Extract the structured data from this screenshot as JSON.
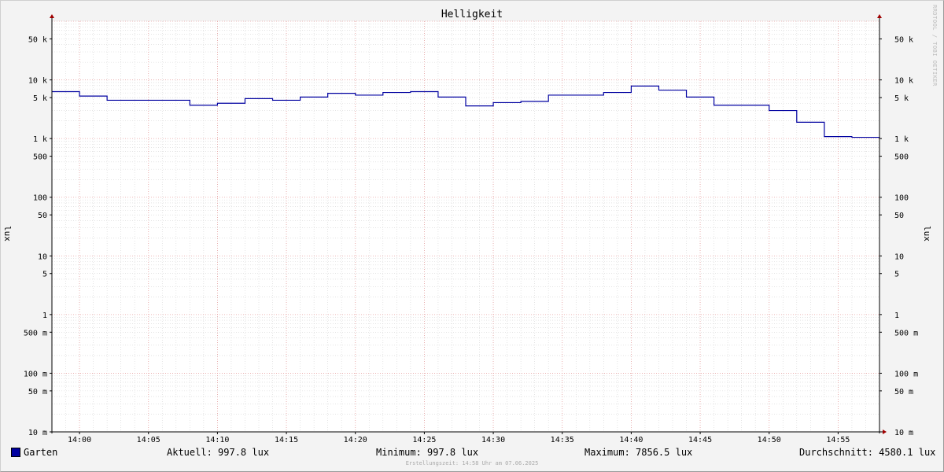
{
  "window": {
    "watermark": "RRDTOOL / TOBI OETIKER"
  },
  "chart_data": {
    "type": "line",
    "title": "Helligkeit",
    "ylabel": "lux",
    "ylabel_right": "lux",
    "y_scale": "log",
    "ylim": [
      0.01,
      100000
    ],
    "y_ticks": [
      {
        "value": 50000,
        "label": "50 k"
      },
      {
        "value": 10000,
        "label": "10 k"
      },
      {
        "value": 5000,
        "label": "5 k"
      },
      {
        "value": 1000,
        "label": "1 k"
      },
      {
        "value": 500,
        "label": "500"
      },
      {
        "value": 100,
        "label": "100"
      },
      {
        "value": 50,
        "label": "50"
      },
      {
        "value": 10,
        "label": "10"
      },
      {
        "value": 5,
        "label": "5"
      },
      {
        "value": 1,
        "label": "1"
      },
      {
        "value": 0.5,
        "label": "500 m"
      },
      {
        "value": 0.1,
        "label": "100 m"
      },
      {
        "value": 0.05,
        "label": "50 m"
      },
      {
        "value": 0.01,
        "label": "10 m"
      }
    ],
    "xlim": [
      "13:58",
      "14:58"
    ],
    "x_ticks": [
      "14:00",
      "14:05",
      "14:10",
      "14:15",
      "14:20",
      "14:25",
      "14:30",
      "14:35",
      "14:40",
      "14:45",
      "14:50",
      "14:55"
    ],
    "grid": true,
    "legend_position": "bottom-left",
    "colors": {
      "line": "#0000a0",
      "grid_major": "#e8a0a0",
      "grid_minor": "#d4d4d4",
      "axis": "#000000"
    },
    "series": [
      {
        "name": "Garten",
        "step": true,
        "x": [
          "13:58",
          "14:00",
          "14:02",
          "14:06",
          "14:08",
          "14:10",
          "14:12",
          "14:14",
          "14:16",
          "14:18",
          "14:20",
          "14:22",
          "14:24",
          "14:26",
          "14:28",
          "14:30",
          "14:32",
          "14:34",
          "14:38",
          "14:40",
          "14:42",
          "14:44",
          "14:46",
          "14:50",
          "14:52",
          "14:54",
          "14:56",
          "14:58"
        ],
        "values": [
          6300,
          5300,
          4500,
          4500,
          3700,
          4000,
          4800,
          4500,
          5100,
          5900,
          5500,
          6100,
          6300,
          5100,
          3600,
          4100,
          4300,
          5500,
          6100,
          7856.5,
          6700,
          5100,
          3700,
          3000,
          1900,
          1080,
          1050,
          997.8
        ]
      }
    ],
    "stats": {
      "aktuell": "Aktuell: 997.8 lux",
      "minimum": "Minimum: 997.8 lux",
      "maximum": "Maximum: 7856.5 lux",
      "durchschnitt": "Durchschnitt: 4580.1 lux"
    }
  },
  "footer": {
    "created": "Erstellungszeit: 14:58 Uhr am 07.06.2025"
  }
}
